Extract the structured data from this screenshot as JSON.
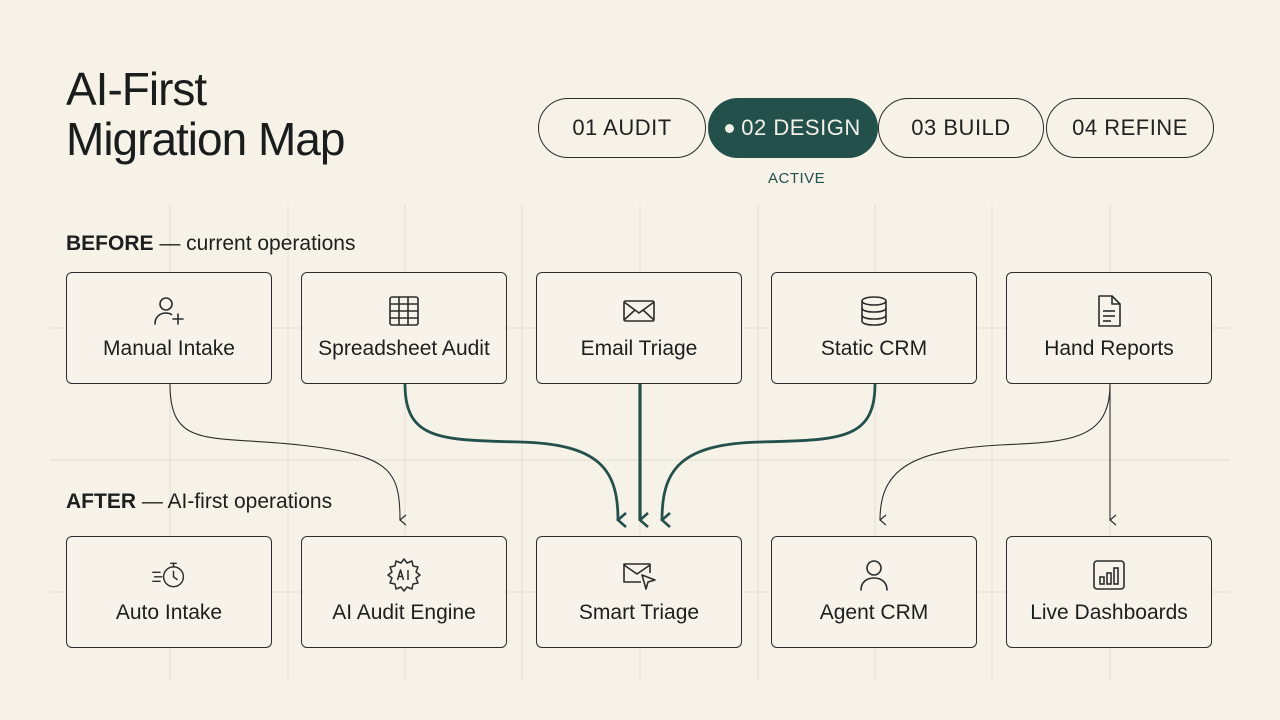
{
  "title": {
    "line1": "AI-First",
    "line2": "Migration Map"
  },
  "steps": [
    {
      "label": "01  AUDIT",
      "active": false
    },
    {
      "label": "02  DESIGN",
      "active": true
    },
    {
      "label": "03  BUILD",
      "active": false
    },
    {
      "label": "04  REFINE",
      "active": false
    }
  ],
  "active_label": "ACTIVE",
  "before": {
    "heading": "BEFORE",
    "subheading": " — current operations"
  },
  "after": {
    "heading": "AFTER",
    "subheading": " — AI-first operations"
  },
  "before_boxes": [
    {
      "label": "Manual Intake",
      "icon": "user-plus-icon"
    },
    {
      "label": "Spreadsheet Audit",
      "icon": "table-icon"
    },
    {
      "label": "Email Triage",
      "icon": "envelope-icon"
    },
    {
      "label": "Static CRM",
      "icon": "database-icon"
    },
    {
      "label": "Hand Reports",
      "icon": "document-icon"
    }
  ],
  "after_boxes": [
    {
      "label": "Auto Intake",
      "icon": "fast-timer-icon"
    },
    {
      "label": "AI Audit Engine",
      "icon": "ai-gear-icon"
    },
    {
      "label": "Smart Triage",
      "icon": "envelope-send-icon"
    },
    {
      "label": "Agent CRM",
      "icon": "person-icon"
    },
    {
      "label": "Live Dashboards",
      "icon": "bar-chart-icon"
    }
  ],
  "colors": {
    "accent": "#24504c",
    "background": "#f6f2e8",
    "ink": "#2a2d2b"
  }
}
